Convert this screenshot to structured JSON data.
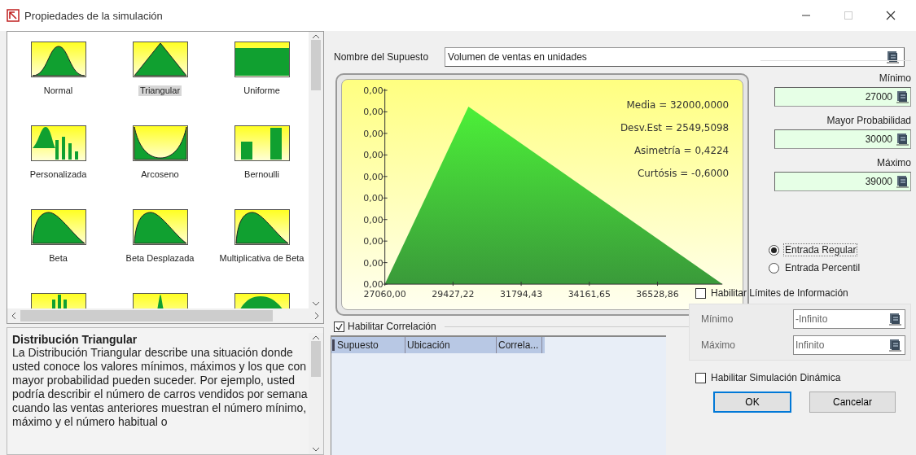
{
  "window": {
    "title": "Propiedades de la simulación"
  },
  "gallery": {
    "items": [
      {
        "label": "Normal",
        "kind": "bell",
        "selected": false
      },
      {
        "label": "Triangular",
        "kind": "triangle",
        "selected": true
      },
      {
        "label": "Uniforme",
        "kind": "uniform",
        "selected": false
      },
      {
        "label": "Personalizada",
        "kind": "custom",
        "selected": false
      },
      {
        "label": "Arcoseno",
        "kind": "arcsine",
        "selected": false
      },
      {
        "label": "Bernoulli",
        "kind": "bernoulli",
        "selected": false
      },
      {
        "label": "Beta",
        "kind": "skew",
        "selected": false
      },
      {
        "label": "Beta Desplazada",
        "kind": "skew",
        "selected": false
      },
      {
        "label": "Multiplicativa de Beta",
        "kind": "skew",
        "selected": false
      },
      {
        "kind": "bars",
        "selected": false
      },
      {
        "kind": "spike",
        "selected": false
      },
      {
        "kind": "hump",
        "selected": false
      }
    ]
  },
  "description": {
    "title": "Distribución Triangular",
    "text": "La Distribución Triangular describe una situación donde usted conoce los valores mínimos, máximos y los que con mayor probabilidad pueden suceder. Por ejemplo, usted podría describir el número de carros vendidos por semana cuando las ventas anteriores muestran el número mínimo, máximo y el número habitual o"
  },
  "assumption_name": {
    "label": "Nombre del Supuesto",
    "value": "Volumen de ventas en unidades"
  },
  "chart": {
    "y_tick_labels": [
      "0,00",
      "0,00",
      "0,00",
      "0,00",
      "0,00",
      "0,00",
      "0,00",
      "0,00",
      "0,00",
      "0,00"
    ],
    "x_tick_labels": [
      "27060,00",
      "29427,22",
      "31794,43",
      "34161,65",
      "36528,86"
    ],
    "stats": [
      "Media = 32000,0000",
      "Desv.Est = 2549,5098",
      "Asimetría = 0,4224",
      "Curtósis = -0,6000"
    ]
  },
  "parameters": [
    {
      "label": "Mínimo",
      "value": "27000"
    },
    {
      "label": "Mayor Probabilidad",
      "value": "30000"
    },
    {
      "label": "Máximo",
      "value": "39000"
    }
  ],
  "entry_modes": [
    {
      "label": "Entrada Regular",
      "selected": true
    },
    {
      "label": "Entrada Percentil",
      "selected": false
    }
  ],
  "correlation": {
    "label": "Habilitar Correlación",
    "checked": true,
    "columns": [
      "Supuesto",
      "Ubicación",
      "Correla..."
    ]
  },
  "limits": {
    "label": "Habilitar Límites de Información",
    "checked": false,
    "fields": [
      {
        "label": "Mínimo",
        "value": "-Infinito"
      },
      {
        "label": "Máximo",
        "value": "Infinito"
      }
    ]
  },
  "dynamic": {
    "label": "Habilitar Simulación Dinámica",
    "checked": false
  },
  "buttons": [
    "OK",
    "Cancelar"
  ]
}
